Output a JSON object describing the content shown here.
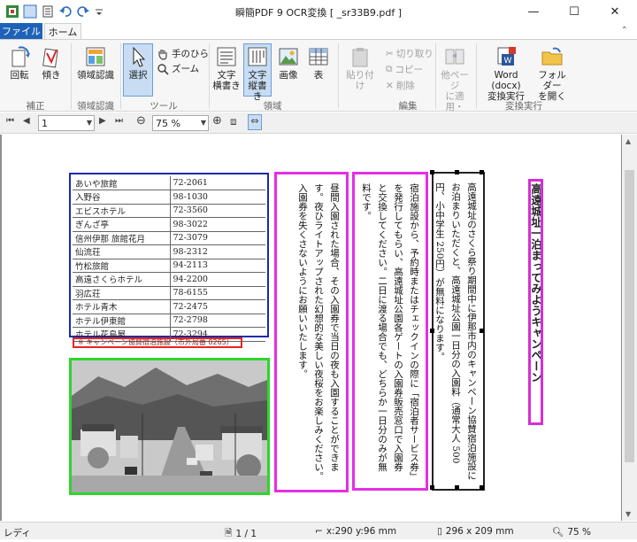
{
  "window": {
    "title": "瞬簡PDF 9 OCR変換 [ _sr33B9.pdf ]",
    "minimize": "—",
    "maximize": "☐",
    "close": "✕"
  },
  "tabs": {
    "file": "ファイル",
    "home": "ホーム"
  },
  "ribbon": {
    "rotate": "回転",
    "skew": "傾き",
    "area_recog": "領域認識",
    "select": "選択",
    "hand": "手のひら",
    "zoom": "ズーム",
    "text_horizontal": [
      "文字",
      "横書き"
    ],
    "text_vertical": [
      "文字",
      "縦書き"
    ],
    "image": "画像",
    "table": "表",
    "paste": "貼り付け",
    "cut": "切り取り",
    "copy": "コピー",
    "delete": "削除",
    "apply_other": [
      "他ページ",
      "に適用・"
    ],
    "word_convert": [
      "Word (docx)",
      "変換実行"
    ],
    "open_folder": [
      "フォルダー",
      "を開く"
    ],
    "groups": {
      "correct": "補正",
      "area_recog": "領域認識",
      "tools": "ツール",
      "region": "領域",
      "edit": "編集",
      "convert": "変換実行"
    }
  },
  "nav": {
    "page": "1",
    "zoom": "75 %"
  },
  "doc": {
    "table_rows": [
      [
        "あいや旅館",
        "72-2061"
      ],
      [
        "入野谷",
        "98-1030"
      ],
      [
        "エビスホテル",
        "72-3560"
      ],
      [
        "ぎんざ亭",
        "98-3022"
      ],
      [
        "信州伊那 旅館花月",
        "72-3079"
      ],
      [
        "仙流荘",
        "98-2312"
      ],
      [
        "竹松旅館",
        "94-2113"
      ],
      [
        "高遠さくらホテル",
        "94-2200"
      ],
      [
        "羽広荘",
        "78-6155"
      ],
      [
        "ホテル青木",
        "72-2475"
      ],
      [
        "ホテル伊東館",
        "72-2798"
      ],
      [
        "ホテル花鳥屋",
        "72-3294"
      ]
    ],
    "caption": "※ キャンペーン協賛宿泊施設（市外局番 0265）",
    "col1": "昼間入園された場合、その入園券で当日の夜も入園することができます。夜ひライトアップされた幻想的な美しい夜桜をお楽しみください。入園券を失くさないようにお願いいたします。",
    "col2": "宿泊施設から、予約時またはチェックインの際に「宿泊者サービス券」を発行してもらい、高遠城址公園各ゲートの入園券販売窓口で入園券と交換してください。二日に渡る場合でも、どちらか一日分のみが無料です。",
    "col3": "高遠城址のさくら祭り期間中に伊那市内のキャンペーン協賛宿泊施設にお泊まりいただくと、高遠城址公園一日分の入園料（通常大人 500円、小中学生 250円）が無料になります。",
    "heading": "高遠城址一泊まってみようキャンペーン"
  },
  "status": {
    "ready": "レディ",
    "page": "1 / 1",
    "coords": "x:290 y:96 mm",
    "size": "296 x 209 mm",
    "zoom": "75 %"
  }
}
